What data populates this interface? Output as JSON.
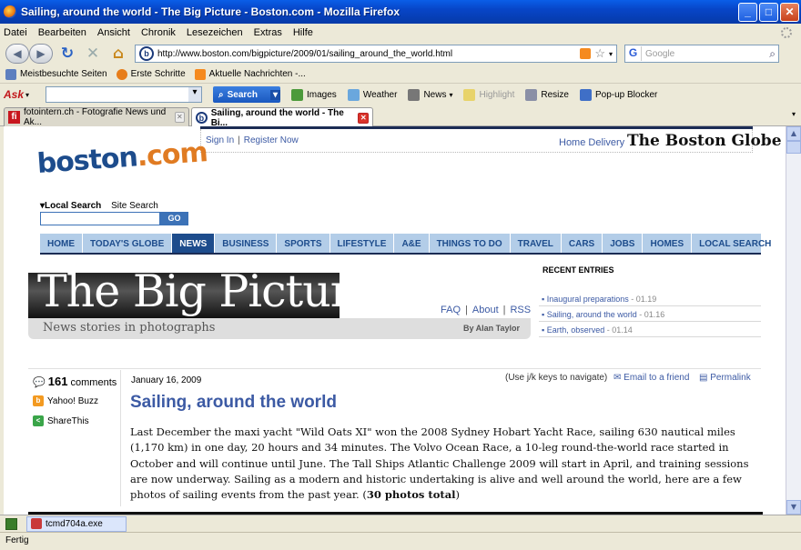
{
  "window": {
    "title": "Sailing, around the world - The Big Picture - Boston.com - Mozilla Firefox"
  },
  "menu": [
    "Datei",
    "Bearbeiten",
    "Ansicht",
    "Chronik",
    "Lesezeichen",
    "Extras",
    "Hilfe"
  ],
  "nav": {
    "url": "http://www.boston.com/bigpicture/2009/01/sailing_around_the_world.html",
    "search_placeholder": "Google"
  },
  "bookmarks": [
    "Meistbesuchte Seiten",
    "Erste Schritte",
    "Aktuelle Nachrichten -..."
  ],
  "ask_toolbar": {
    "search_label": "Search",
    "tools": [
      "Images",
      "Weather",
      "News",
      "Highlight",
      "Resize",
      "Pop-up Blocker"
    ]
  },
  "tabs": [
    {
      "label": "fotointern.ch - Fotografie News und Ak...",
      "icon": "fi"
    },
    {
      "label": "Sailing, around the world - The Bi...",
      "icon": "b"
    }
  ],
  "page": {
    "sign_in": "Sign In",
    "register": "Register Now",
    "home_delivery": "Home Delivery",
    "globe": "The Boston Globe",
    "logo_main": "boston",
    "logo_dot": ".com",
    "local_search": "Local Search",
    "site_search": "Site Search",
    "go": "GO",
    "nav": [
      "HOME",
      "TODAY'S GLOBE",
      "NEWS",
      "BUSINESS",
      "SPORTS",
      "LIFESTYLE",
      "A&E",
      "THINGS TO DO",
      "TRAVEL",
      "CARS",
      "JOBS",
      "HOMES",
      "LOCAL SEARCH"
    ],
    "banner_title": "The Big Picture",
    "tagline": "News stories in photographs",
    "byline": "By Alan Taylor",
    "faq": "FAQ",
    "about": "About",
    "rss": "RSS",
    "recent_heading": "RECENT ENTRIES",
    "recent": [
      {
        "title": "Inaugural preparations",
        "date": "- 01.19"
      },
      {
        "title": "Sailing, around the world",
        "date": "- 01.16"
      },
      {
        "title": "Earth, observed",
        "date": "- 01.14"
      }
    ],
    "comment_count": "161",
    "comments_label": "comments",
    "yahoo_buzz": "Yahoo! Buzz",
    "share_this": "ShareThis",
    "post_date": "January 16, 2009",
    "nav_hint": "(Use j/k keys to navigate)",
    "email_friend": "Email to a friend",
    "permalink": "Permalink",
    "post_title": "Sailing, around the world",
    "body_text": "Last December the maxi yacht \"Wild Oats XI\" won the 2008 Sydney Hobart Yacht Race, sailing 630 nautical miles (1,170 km) in one day, 20 hours and 34 minutes. The Volvo Ocean Race, a 10-leg round-the-world race started in October and will continue until June. The Tall Ships Atlantic Challenge 2009 will start in April, and training sessions are now underway. Sailing as a modern and historic undertaking is alive and well around the world, here are a few photos of sailing events from the past year. (",
    "photos_total": "30 photos total",
    "body_end": ")"
  },
  "download": {
    "file": "tcmd704a.exe"
  },
  "status": {
    "text": "Fertig"
  }
}
